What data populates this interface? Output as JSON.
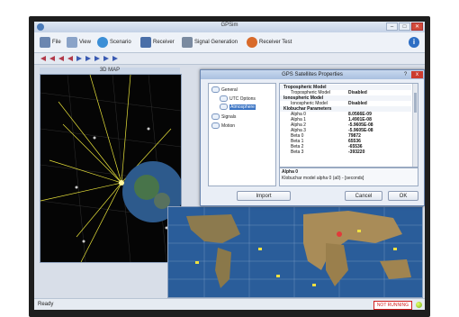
{
  "app": {
    "title": "GPSim"
  },
  "menu": [
    {
      "label": "File",
      "icon": "file-icon",
      "color": "#6b86b0"
    },
    {
      "label": "View",
      "icon": "view-icon",
      "color": "#8aa3c8"
    },
    {
      "label": "Scenario",
      "icon": "globe-icon",
      "color": "#3c8fd6"
    },
    {
      "label": "Receiver",
      "icon": "plane-icon",
      "color": "#4a6fa8"
    },
    {
      "label": "Signal Generation",
      "icon": "signal-icon",
      "color": "#7a8aa0"
    },
    {
      "label": "Receiver Test",
      "icon": "test-icon",
      "color": "#d86a2a"
    }
  ],
  "map": {
    "title": "3D MAP"
  },
  "dialog": {
    "title": "GPS Satellites Properties",
    "help": "?",
    "close": "x",
    "tree": [
      {
        "label": "General"
      },
      {
        "label": "UTC Options"
      },
      {
        "label": "Atmosphere",
        "selected": true
      },
      {
        "label": "Signals"
      },
      {
        "label": "Motion"
      }
    ],
    "props": [
      {
        "name": "Tropospheric Model",
        "value": "",
        "category": true
      },
      {
        "name": "Tropospheric Model",
        "value": "Disabled"
      },
      {
        "name": "Ionospheric Model",
        "value": "",
        "category": true
      },
      {
        "name": "Ionospheric Model",
        "value": "Disabled"
      },
      {
        "name": "Klobuchar Parameters",
        "value": "",
        "category": true
      },
      {
        "name": "Alpha 0",
        "value": "8.0566E-09"
      },
      {
        "name": "Alpha 1",
        "value": "1.4901E-08"
      },
      {
        "name": "Alpha 2",
        "value": "-5.9605E-08"
      },
      {
        "name": "Alpha 3",
        "value": "-5.9605E-08"
      },
      {
        "name": "Beta 0",
        "value": "79872"
      },
      {
        "name": "Beta 1",
        "value": "65536"
      },
      {
        "name": "Beta 2",
        "value": "-65536"
      },
      {
        "name": "Beta 3",
        "value": "-393220"
      }
    ],
    "description": {
      "title": "Alpha 0",
      "text": "Klobuchar model alpha 0 (a0) - [seconds]"
    },
    "buttons": {
      "import": "Import",
      "cancel": "Cancel",
      "ok": "OK"
    }
  },
  "status": {
    "ready": "Ready",
    "running": "NOT RUNNING"
  }
}
